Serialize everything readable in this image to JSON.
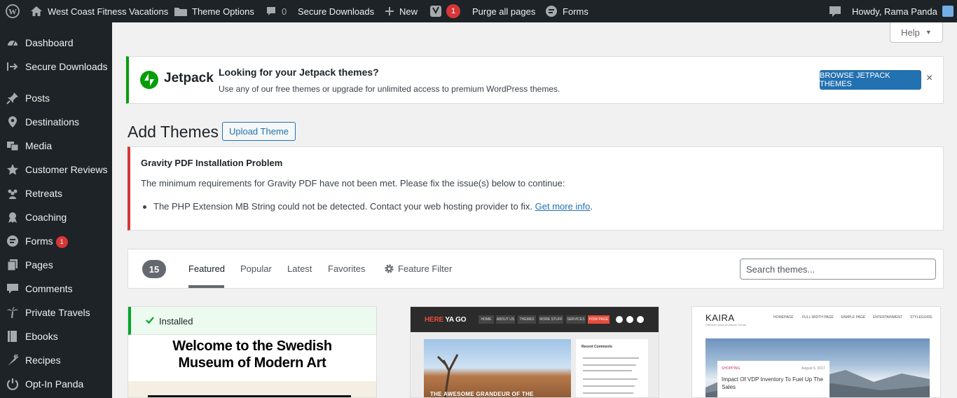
{
  "admin_bar": {
    "site_name": "West Coast Fitness Vacations",
    "theme_options": "Theme Options",
    "comments_count": "0",
    "secure_downloads": "Secure Downloads",
    "new": "New",
    "yoast_count": "1",
    "purge": "Purge all pages",
    "forms": "Forms",
    "howdy": "Howdy, Rama Panda"
  },
  "sidebar": {
    "items": [
      {
        "label": "Dashboard",
        "icon": "dashboard-icon"
      },
      {
        "label": "Secure Downloads",
        "icon": "download-arrow-icon"
      },
      {
        "label": "Posts",
        "icon": "pin-icon"
      },
      {
        "label": "Destinations",
        "icon": "location-icon"
      },
      {
        "label": "Media",
        "icon": "media-icon"
      },
      {
        "label": "Customer Reviews",
        "icon": "star-icon"
      },
      {
        "label": "Retreats",
        "icon": "groups-icon"
      },
      {
        "label": "Coaching",
        "icon": "awards-icon"
      },
      {
        "label": "Forms",
        "icon": "forms-icon",
        "badge": "1"
      },
      {
        "label": "Pages",
        "icon": "pages-icon"
      },
      {
        "label": "Comments",
        "icon": "comments-icon"
      },
      {
        "label": "Private Travels",
        "icon": "palm-tree-icon"
      },
      {
        "label": "Ebooks",
        "icon": "book-icon"
      },
      {
        "label": "Recipes",
        "icon": "carrot-icon"
      },
      {
        "label": "Opt-In Panda",
        "icon": "power-icon"
      }
    ]
  },
  "help": {
    "label": "Help"
  },
  "jetpack_notice": {
    "brand": "Jetpack",
    "title": "Looking for your Jetpack themes?",
    "subtitle": "Use any of our free themes or upgrade for unlimited access to premium WordPress themes.",
    "button": "BROWSE JETPACK THEMES",
    "close": "×"
  },
  "page": {
    "title": "Add Themes",
    "upload_button": "Upload Theme"
  },
  "gravity_notice": {
    "title": "Gravity PDF Installation Problem",
    "message": "The minimum requirements for Gravity PDF have not been met. Please fix the issue(s) below to continue:",
    "issue": "The PHP Extension MB String could not be detected. Contact your web hosting provider to fix.",
    "link": "Get more info"
  },
  "filter": {
    "count": "15",
    "tabs": [
      "Featured",
      "Popular",
      "Latest",
      "Favorites"
    ],
    "feature_filter": "Feature Filter",
    "search_placeholder": "Search themes..."
  },
  "themes": {
    "card1": {
      "installed": "Installed",
      "preview_title_line1": "Welcome to the Swedish",
      "preview_title_line2": "Museum of Modern Art"
    },
    "card2": {
      "logo_here": "HERE",
      "logo_rest": " YA GO",
      "nav": [
        "HOME",
        "ABOUT US",
        "THEMES",
        "MORE STUFF",
        "SERVICES",
        "HOW PAGE"
      ],
      "side_title": "Recent Comments",
      "photo_caption": "THE AWESOME GRANDEUR OF THE"
    },
    "card3": {
      "logo": "KAIRA",
      "tagline": "Premium WooCommerce Theme",
      "nav": [
        "HOMEPAGE",
        "FULL WIDTH PAGE",
        "SAMPLE PAGE",
        "ENTERTAINMENT",
        "STYLEGUIDE"
      ],
      "category": "SHOPPING",
      "date": "August 6, 2017",
      "post_title": "Impact Of VDP Inventory To Fuel Up The Sales"
    }
  },
  "colors": {
    "admin_bg": "#1d2327",
    "accent": "#2271b1",
    "jetpack_green": "#069e08",
    "error_red": "#d63638",
    "installed_green": "#00a32a"
  }
}
